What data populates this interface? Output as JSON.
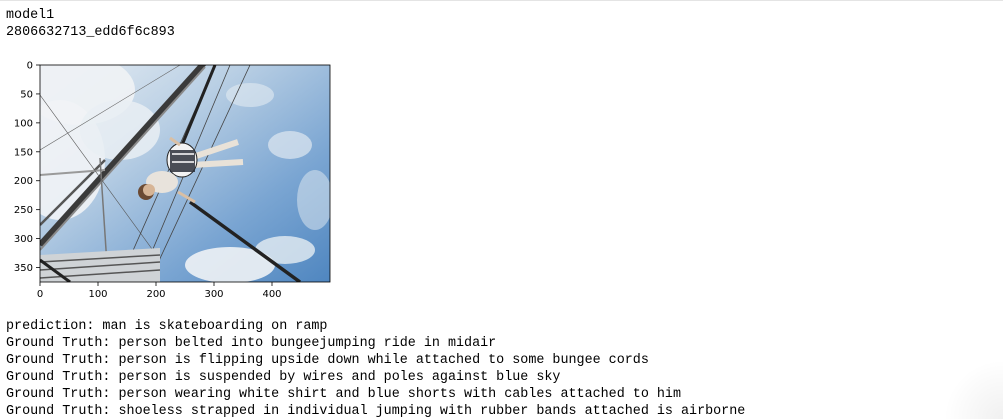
{
  "header": {
    "model_name": "model1",
    "image_id": "2806632713_edd6f6c893"
  },
  "plot": {
    "x_ticks": [
      "0",
      "100",
      "200",
      "300",
      "400"
    ],
    "y_ticks": [
      "0",
      "50",
      "100",
      "150",
      "200",
      "250",
      "300",
      "350"
    ],
    "x_tick_values": [
      0,
      100,
      200,
      300,
      400
    ],
    "y_tick_values": [
      0,
      50,
      100,
      150,
      200,
      250,
      300,
      350
    ],
    "image_width": 500,
    "image_height": 375,
    "image_subject": "man suspended upside down by bungee cords against blue sky",
    "colors": {
      "sky_top": "#d6e2ee",
      "sky_bottom": "#5d8fc4",
      "cloud": "#f4f6f8"
    }
  },
  "output": {
    "prediction": "prediction: man is skateboarding on ramp",
    "ground_truths": [
      "Ground Truth: person belted into bungeejumping ride in midair",
      "Ground Truth: person is flipping upside down while attached to some bungee cords",
      "Ground Truth: person is suspended by wires and poles against blue sky",
      "Ground Truth: person wearing white shirt and blue shorts with cables attached to him",
      "Ground Truth: shoeless strapped in individual jumping with rubber bands attached is airborne"
    ]
  }
}
